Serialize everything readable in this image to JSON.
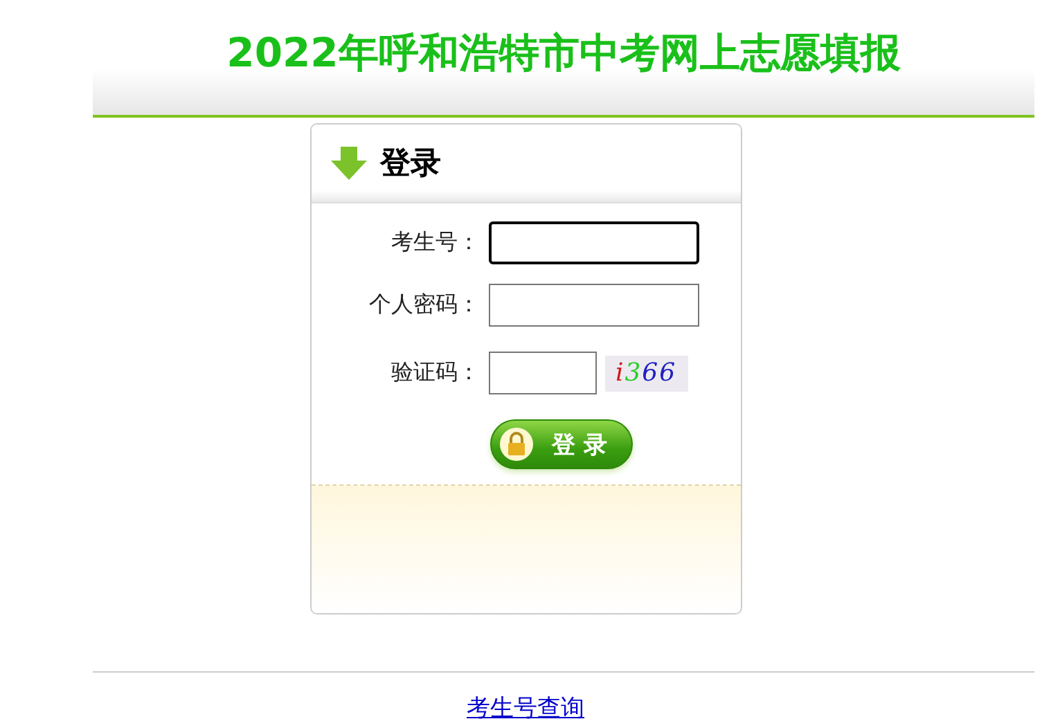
{
  "header": {
    "title": "2022年呼和浩特市中考网上志愿填报"
  },
  "login": {
    "title": "登录",
    "fields": [
      {
        "label": "考生号：",
        "kind": "text",
        "focused": true
      },
      {
        "label": "个人密码：",
        "kind": "text",
        "focused": false
      },
      {
        "label": "验证码：",
        "kind": "captcha",
        "focused": false,
        "captcha": "i366"
      }
    ],
    "button": "登 录"
  },
  "footer": {
    "link": "考生号查询"
  }
}
